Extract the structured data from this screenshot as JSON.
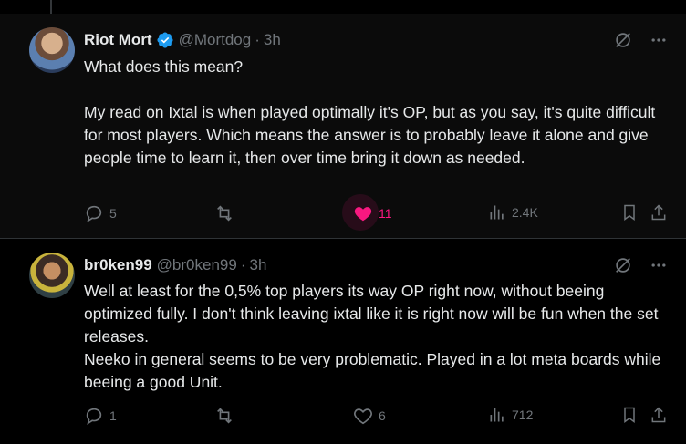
{
  "tweets": [
    {
      "name": "Riot Mort",
      "handle": "@Mortdog",
      "dot": "·",
      "time": "3h",
      "verified": true,
      "body": [
        "What does this mean?",
        "",
        "My read on Ixtal is when played optimally it's OP, but as you say, it's quite difficult for most players. Which means the answer is to probably leave it alone and give people time to learn it, then over time bring it down as needed."
      ],
      "replies": "5",
      "retweets": "",
      "likes": "11",
      "views": "2.4K",
      "liked": true
    },
    {
      "name": "br0ken99",
      "handle": "@br0ken99",
      "dot": "·",
      "time": "3h",
      "verified": false,
      "body": [
        "Well at least for the 0,5% top players its way OP right now, without beeing optimized fully. I don't think leaving ixtal like it is right now will be fun when the set releases.",
        "Neeko in general seems to be very problematic. Played in a lot meta boards while beeing a good Unit."
      ],
      "replies": "1",
      "retweets": "",
      "likes": "6",
      "views": "712",
      "liked": false
    }
  ],
  "colors": {
    "accent": "#1d9bf0",
    "like": "#f91880",
    "muted": "#71767b",
    "text": "#e7e9ea",
    "background": "#000000"
  },
  "icons": [
    "reply-icon",
    "retweet-icon",
    "heart-icon",
    "views-icon",
    "bookmark-icon",
    "share-icon",
    "grok-icon",
    "more-icon",
    "verified-icon"
  ]
}
